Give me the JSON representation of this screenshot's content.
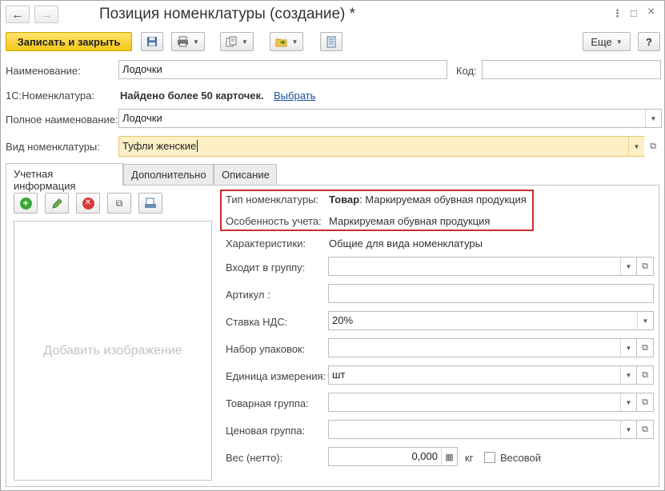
{
  "window": {
    "title": "Позиция номенклатуры (создание) *",
    "back_icon": "arrow-left",
    "forward_icon": "arrow-right",
    "menu_icon": "⋮",
    "maximize_icon": "□",
    "close_icon": "×"
  },
  "toolbar": {
    "save_close_label": "Записать и закрыть",
    "more_label": "Еще",
    "help_label": "?"
  },
  "form": {
    "name_label": "Наименование:",
    "name_value": "Лодочки",
    "code_label": "Код:",
    "code_value": "",
    "c1_label": "1С:Номенклатура:",
    "c1_found": "Найдено более 50 карточек.",
    "c1_select_link": "Выбрать",
    "full_name_label": "Полное наименование:",
    "full_name_value": "Лодочки",
    "kind_label": "Вид номенклатуры:",
    "kind_value": "Туфли женские"
  },
  "tabs": [
    "Учетная информация",
    "Дополнительно",
    "Описание"
  ],
  "image_area": {
    "placeholder": "Добавить изображение"
  },
  "details": {
    "type_label": "Тип номенклатуры:",
    "type_value_bold": "Товар",
    "type_value_rest": ": Маркируемая обувная продукция",
    "feature_label": "Особенность учета:",
    "feature_value": "Маркируемая обувная продукция",
    "characteristics_label": "Характеристики:",
    "characteristics_value": "Общие для вида номенклатуры",
    "group_label": "Входит в группу:",
    "group_value": "",
    "article_label": "Артикул :",
    "article_value": "",
    "vat_label": "Ставка НДС:",
    "vat_value": "20%",
    "packaging_label": "Набор упаковок:",
    "packaging_value": "",
    "unit_label": "Единица измерения:",
    "unit_value": "шт",
    "product_group_label": "Товарная группа:",
    "product_group_value": "",
    "price_group_label": "Ценовая группа:",
    "price_group_value": "",
    "weight_label": "Вес (нетто):",
    "weight_value": "0,000",
    "weight_unit": "кг",
    "weighted_label": "Весовой"
  },
  "colors": {
    "primary_button": "#f5c718",
    "highlight_field": "#fdf0c6",
    "red_box": "#cf2b2b",
    "link": "#1a4f9c"
  }
}
